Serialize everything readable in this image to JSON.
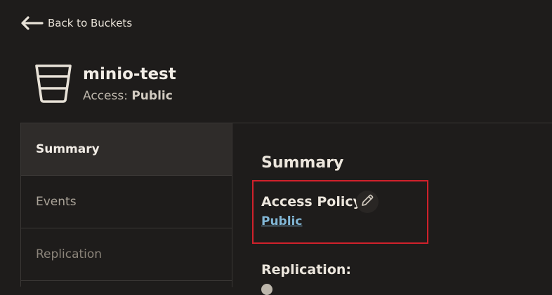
{
  "nav": {
    "back_label": "Back to Buckets"
  },
  "bucket": {
    "name": "minio-test",
    "access_label": "Access:",
    "access_value": "Public"
  },
  "sidebar": {
    "items": [
      {
        "label": "Summary"
      },
      {
        "label": "Events"
      },
      {
        "label": "Replication"
      }
    ]
  },
  "summary": {
    "title": "Summary",
    "access_policy_label": "Access Policy:",
    "access_policy_value": "Public",
    "replication_label": "Replication:"
  },
  "colors": {
    "background": "#1e1c1b",
    "highlight_border": "#d0212b",
    "link": "#82b7d6",
    "active_item_bg": "#2f2c2a"
  },
  "icons": {
    "back": "arrow-left-icon",
    "bucket": "bucket-icon",
    "edit": "pencil-icon"
  }
}
